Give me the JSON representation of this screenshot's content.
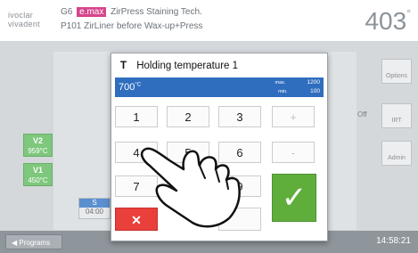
{
  "header": {
    "logo_line1": "ivoclar",
    "logo_line2": "vivadent",
    "code": "G6",
    "badge": "e.max",
    "program_name": "ZirPress Staining Tech.",
    "program_id": "P101",
    "program_desc": "ZirLiner before Wax-up+Press",
    "temperature": "403",
    "temperature_unit": "°"
  },
  "background": {
    "v2_label": "V2",
    "v2_value": "959°C",
    "v1_label": "V1",
    "v1_value": "450°C",
    "s_label": "S",
    "s_value": "04:00",
    "off_label": "Off",
    "side_buttons": [
      "Options",
      "IRT",
      "Admin"
    ]
  },
  "dialog": {
    "title_icon": "T",
    "title": "Holding temperature 1",
    "value": "700",
    "value_unit": "°C",
    "max_label": "max.",
    "max_value": "1200",
    "min_label": "min.",
    "min_value": "100",
    "keys": {
      "k1": "1",
      "k2": "2",
      "k3": "3",
      "plus": "+",
      "k4": "4",
      "k5": "5",
      "k6": "6",
      "minus": "-",
      "k7": "7",
      "k8": "8",
      "k9": "9",
      "cancel": "✕",
      "ok": "✓"
    }
  },
  "footer": {
    "programs": "Programs",
    "clock": "14:58:21"
  },
  "colors": {
    "accent_blue": "#2f6ebe",
    "ok_green": "#5fae3c",
    "cancel_red": "#e9403b",
    "badge_pink": "#d6458c"
  }
}
